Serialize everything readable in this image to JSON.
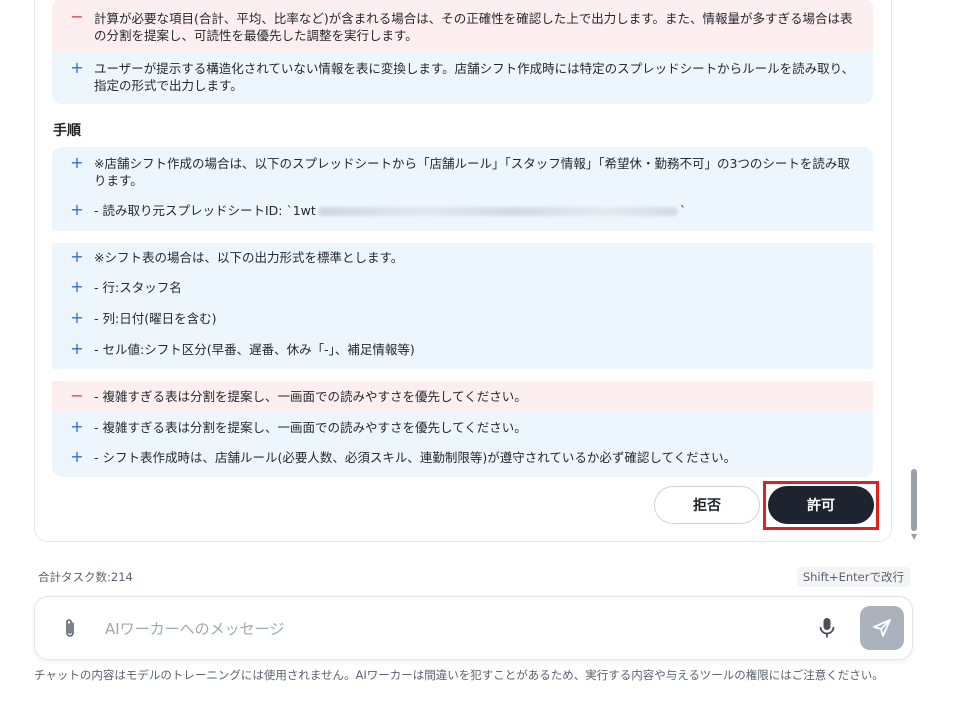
{
  "diff_top": [
    {
      "type": "del",
      "sign": "−",
      "text": "計算が必要な項目(合計、平均、比率など)が含まれる場合は、その正確性を確認した上で出力します。また、情報量が多すぎる場合は表の分割を提案し、可読性を最優先した調整を実行します。"
    },
    {
      "type": "add",
      "sign": "+",
      "text": "ユーザーが提示する構造化されていない情報を表に変換します。店舗シフト作成時には特定のスプレッドシートからルールを読み取り、指定の形式で出力します。"
    }
  ],
  "section_title": "手順",
  "steps_group1": [
    {
      "sign": "+",
      "text": "※店舗シフト作成の場合は、以下のスプレッドシートから「店舗ルール」「スタッフ情報」「希望休・勤務不可」の3つのシートを読み取ります。"
    },
    {
      "sign": "+",
      "text_prefix": "- 読み取り元スプレッドシートID: `1wt",
      "text_suffix": "`"
    }
  ],
  "steps_group2": [
    {
      "sign": "+",
      "text": "※シフト表の場合は、以下の出力形式を標準とします。"
    },
    {
      "sign": "+",
      "text": "- 行:スタッフ名"
    },
    {
      "sign": "+",
      "text": "- 列:日付(曜日を含む)"
    },
    {
      "sign": "+",
      "text": "- セル値:シフト区分(早番、遅番、休み「-」、補足情報等)"
    }
  ],
  "steps_group3": [
    {
      "type": "del",
      "sign": "−",
      "text": "- 複雑すぎる表は分割を提案し、一画面での読みやすさを優先してください。"
    },
    {
      "type": "add",
      "sign": "+",
      "text": "- 複雑すぎる表は分割を提案し、一画面での読みやすさを優先してください。"
    },
    {
      "type": "add",
      "sign": "+",
      "text": "- シフト表作成時は、店舗ルール(必要人数、必須スキル、連勤制限等)が遵守されているか必ず確認してください。"
    }
  ],
  "actions": {
    "reject_label": "拒否",
    "allow_label": "許可"
  },
  "meta": {
    "task_count": "合計タスク数:214",
    "shortcut_hint": "Shift+Enterで改行"
  },
  "composer": {
    "placeholder": "AIワーカーへのメッセージ"
  },
  "footer_note": "チャットの内容はモデルのトレーニングには使用されません。AIワーカーは間違いを犯すことがあるため、実行する内容や与えるツールの権限にはご注意ください。",
  "colors": {
    "add_bg": "#eef6fd",
    "del_bg": "#fdeef0",
    "add_sign": "#2f6fd8",
    "del_sign": "#d64550",
    "primary_button": "#1e2330",
    "highlight_box": "#e3211c"
  },
  "icons": {
    "attach": "paperclip-icon",
    "mic": "microphone-icon",
    "send": "send-icon"
  }
}
